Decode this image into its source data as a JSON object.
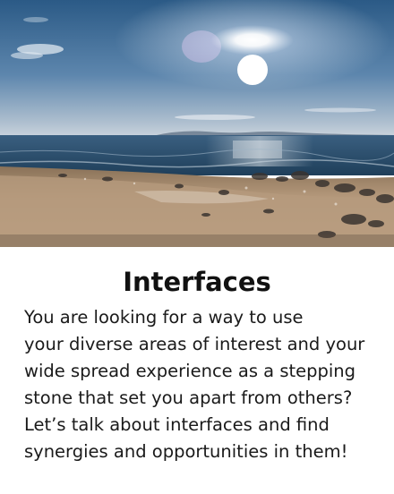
{
  "card": {
    "image": {
      "icon": "seaside-sunset-photo"
    },
    "title": "Interfaces",
    "body_lines": [
      "You are looking for a way to use",
      "your diverse areas of interest and your",
      "wide spread experience as a stepping",
      "stone that set you apart from others?",
      "Let’s talk about interfaces and find",
      "synergies and opportunities in them!"
    ]
  },
  "colors": {
    "sky_top": "#2f5f8a",
    "sky_horizon": "#b9c9d6",
    "sea": "#264c6a",
    "sand": "#b79a7a",
    "title": "#111111",
    "text": "#1a1a1a"
  }
}
